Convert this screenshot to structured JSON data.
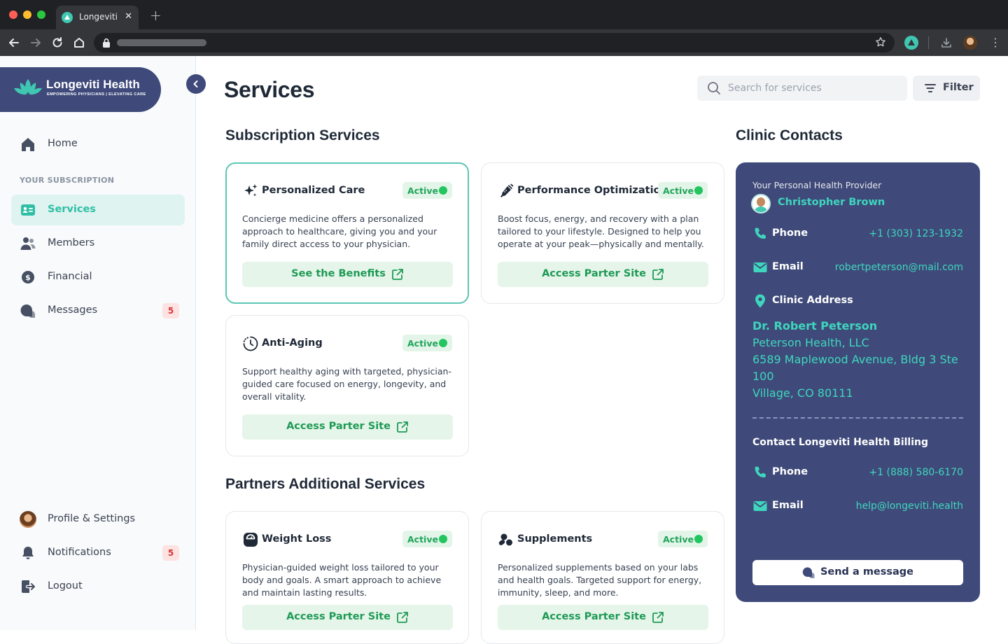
{
  "browser": {
    "tab_title": "Longeviti",
    "new_tab": "+",
    "close": "✕"
  },
  "brand": {
    "name": "Longeviti Health",
    "tagline": "EMPOWERING PHYSICIANS | ELEVATING CARE",
    "color": "#3f4a7a",
    "accent": "#3fc7b2"
  },
  "sidebar": {
    "home": "Home",
    "section_label": "YOUR SUBSCRIPTION",
    "items": [
      {
        "label": "Services",
        "icon": "id-card-icon",
        "active": true
      },
      {
        "label": "Members",
        "icon": "members-icon"
      },
      {
        "label": "Financial",
        "icon": "dollar-icon"
      },
      {
        "label": "Messages",
        "icon": "chat-icon",
        "badge": "5"
      }
    ],
    "bottom": [
      {
        "label": "Profile & Settings",
        "icon": "avatar"
      },
      {
        "label": "Notifications",
        "icon": "bell-icon",
        "badge": "5"
      },
      {
        "label": "Logout",
        "icon": "logout-icon"
      }
    ]
  },
  "header": {
    "title": "Services",
    "search_placeholder": "Search for services",
    "filter_label": "Filter"
  },
  "subscription": {
    "title": "Subscription Services",
    "cards": [
      {
        "title": "Personalized Care",
        "icon": "sparkle-icon",
        "status": "Active",
        "description": "Concierge medicine offers a personalized approach to healthcare, giving you and your family direct access to your physician.",
        "button": "See the Benefits"
      },
      {
        "title": "Performance Optimization",
        "icon": "syringe-icon",
        "status": "Active",
        "description": "Boost focus, energy, and recovery with a plan tailored to your lifestyle. Designed to help you operate at your peak—physically and mentally.",
        "button": "Access Parter Site"
      },
      {
        "title": "Anti-Aging",
        "icon": "clock-icon",
        "status": "Active",
        "description": "Support healthy aging with targeted, physician-guided care focused on energy, longevity, and overall vitality.",
        "button": "Access Parter Site"
      }
    ]
  },
  "partners": {
    "title": "Partners Additional Services",
    "cards": [
      {
        "title": "Weight Loss",
        "icon": "scale-icon",
        "status": "Active",
        "description": "Physician-guided weight loss tailored to your body and goals. A smart approach to achieve and maintain lasting results.",
        "button": "Access Parter Site"
      },
      {
        "title": "Supplements",
        "icon": "pills-icon",
        "status": "Active",
        "description": "Personalized supplements based on your labs and health goals. Targeted support for energy, immunity, sleep, and more.",
        "button": "Access Parter Site"
      }
    ]
  },
  "contacts": {
    "title": "Clinic Contacts",
    "provider_label": "Your Personal Health Provider",
    "provider_name": "Christopher Brown",
    "phone_label": "Phone",
    "phone": "+1 (303) 123-1932",
    "email_label": "Email",
    "email": "robertpeterson@mail.com",
    "address_label": "Clinic Address",
    "address": {
      "name": "Dr. Robert Peterson",
      "company": "Peterson Health, LLC",
      "line1": "6589 Maplewood Avenue, Bldg 3 Ste",
      "line2": "100",
      "city": "Village, CO 80111"
    },
    "billing_title": "Contact Longeviti Health Billing",
    "billing_phone_label": "Phone",
    "billing_phone": "+1 (888) 580-6170",
    "billing_email_label": "Email",
    "billing_email": "help@longeviti.health",
    "send_button": "Send a message"
  }
}
